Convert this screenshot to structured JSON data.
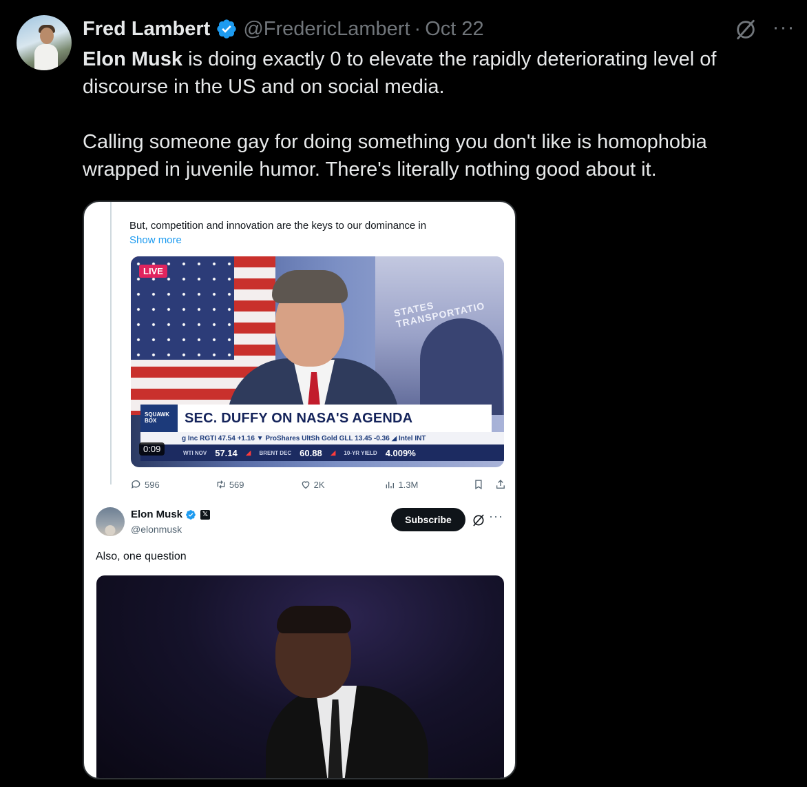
{
  "tweet": {
    "author": {
      "display_name": "Fred Lambert",
      "handle": "@FredericLambert",
      "separator": "·",
      "date": "Oct 22"
    },
    "text": {
      "mention": "Elon Musk",
      "line1_rest": " is doing exactly 0 to elevate the rapidly deteriorating level of discourse in the US and on social media.",
      "paragraph2": "Calling someone gay for doing something you don't like is homophobia wrapped in juvenile humor. There's literally nothing good about it."
    },
    "more_label": "···"
  },
  "embedded": {
    "quote_text": "But, competition and innovation are the keys to our dominance in",
    "show_more": "Show more",
    "video": {
      "live_badge": "LIVE",
      "building_text": "STATES TRANSPORTATIO",
      "chyron_logo": "SQUAWK BOX",
      "chyron_title": "SEC. DUFFY ON NASA'S AGENDA",
      "ticker_top": "g Inc RGTI 47.54 +1.16 ▼   ProShares UltSh Gold GLL 13.45 -0.36 ◢   Intel INT",
      "ticker_items": [
        {
          "label": "WTI NOV",
          "value": "57.14"
        },
        {
          "label": "BRENT DEC",
          "value": "60.88"
        },
        {
          "label": "10-YR YIELD",
          "value": "4.009%"
        }
      ],
      "timestamp": "0:09"
    },
    "actions": {
      "replies": "596",
      "reposts": "569",
      "likes": "2K",
      "views": "1.3M"
    },
    "reply": {
      "name": "Elon Musk",
      "x_badge": "𝕏",
      "handle": "@elonmusk",
      "subscribe_label": "Subscribe",
      "more_label": "···",
      "text": "Also, one question"
    }
  },
  "colors": {
    "background": "#000000",
    "text": "#e7e9ea",
    "muted": "#71767b",
    "verified": "#1d9bf0"
  }
}
